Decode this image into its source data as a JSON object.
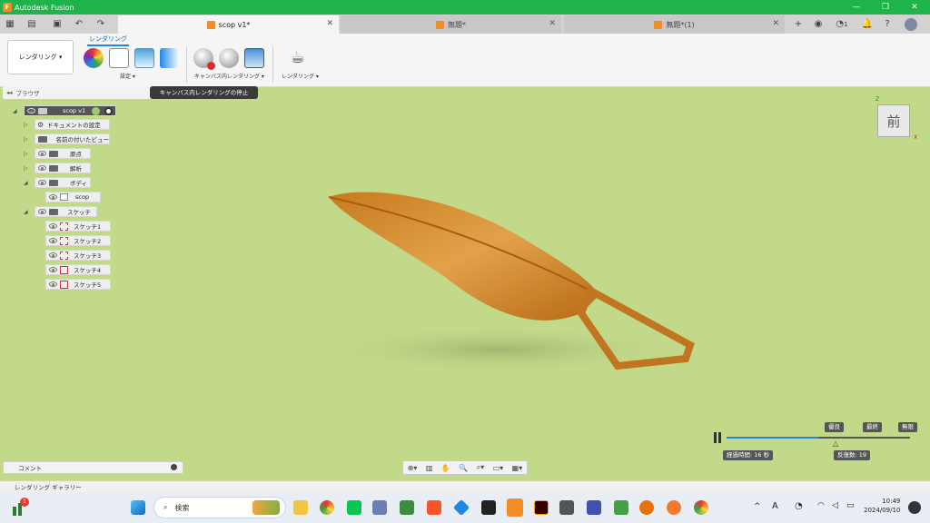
{
  "window": {
    "title": "Autodesk Fusion"
  },
  "tabs": [
    {
      "label": "scop v1*"
    },
    {
      "label": "無題*"
    },
    {
      "label": "無題*(1)"
    }
  ],
  "tabbar": {
    "user_count": "1"
  },
  "ribbon": {
    "workspace_label": "レンダリング ▾",
    "active_tab": "レンダリング",
    "groups": [
      {
        "label": "設定 ▾"
      },
      {
        "label": "キャンバス内レンダリング ▾"
      },
      {
        "label": "レンダリング ▾"
      }
    ],
    "tooltip": "キャンバス内レンダリングの停止"
  },
  "browser": {
    "title": "ブラウザ",
    "root": "scop v1",
    "nodes": [
      {
        "label": "ドキュメントの設定"
      },
      {
        "label": "名前の付いたビュー"
      },
      {
        "label": "原点"
      },
      {
        "label": "解析"
      },
      {
        "label": "ボディ"
      },
      {
        "label": "scop"
      },
      {
        "label": "スケッチ"
      },
      {
        "label": "スケッチ1"
      },
      {
        "label": "スケッチ2"
      },
      {
        "label": "スケッチ3"
      },
      {
        "label": "スケッチ4"
      },
      {
        "label": "スケッチ5"
      }
    ]
  },
  "comment": {
    "label": "コメント"
  },
  "viewcube": {
    "face": "前",
    "z": "Z",
    "x": "X"
  },
  "render_progress": {
    "quality_marks": [
      "優良",
      "最終",
      "無限"
    ],
    "elapsed": "経過時間: 16 秒",
    "iterations": "反復数: 19",
    "progress_fraction": 0.5
  },
  "gallery": {
    "label": "レンダリング ギャラリー"
  },
  "taskbar": {
    "search_label": "検索",
    "badge": "1",
    "time": "10:49",
    "date": "2024/09/10"
  },
  "colors": {
    "titlebar": "#1fb34c",
    "canvas": "#c3d98a",
    "model": "#d4892a",
    "accent": "#1e88e5"
  }
}
